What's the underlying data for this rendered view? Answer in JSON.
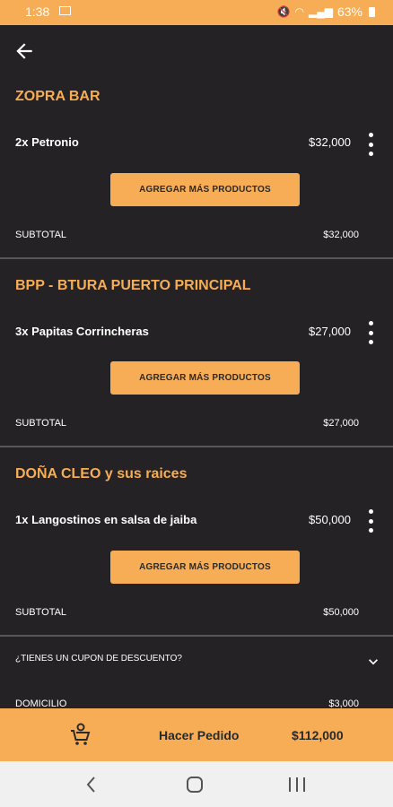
{
  "status_bar": {
    "time": "1:38",
    "battery": "63%"
  },
  "stores": [
    {
      "name": "ZOPRA BAR",
      "item": "2x Petronio",
      "price": "$32,000",
      "add_label": "AGREGAR MÁS PRODUCTOS",
      "subtotal_label": "SUBTOTAL",
      "subtotal": "$32,000"
    },
    {
      "name": "BPP - BTURA PUERTO PRINCIPAL",
      "item": "3x Papitas Corrincheras",
      "price": "$27,000",
      "add_label": "AGREGAR MÁS PRODUCTOS",
      "subtotal_label": "SUBTOTAL",
      "subtotal": "$27,000"
    },
    {
      "name": "DOÑA CLEO y sus raices",
      "item": "1x Langostinos en salsa de jaiba",
      "price": "$50,000",
      "add_label": "AGREGAR MÁS PRODUCTOS",
      "subtotal_label": "SUBTOTAL",
      "subtotal": "$50,000"
    }
  ],
  "coupon": {
    "label": "¿TIENES UN CUPON DE DESCUENTO?"
  },
  "delivery": {
    "label": "DOMICILIO",
    "value": "$3,000"
  },
  "order": {
    "label": "Hacer Pedido",
    "total": "$112,000"
  },
  "colors": {
    "accent": "#f6ad55",
    "background": "#242224",
    "divider": "#5a5658"
  }
}
